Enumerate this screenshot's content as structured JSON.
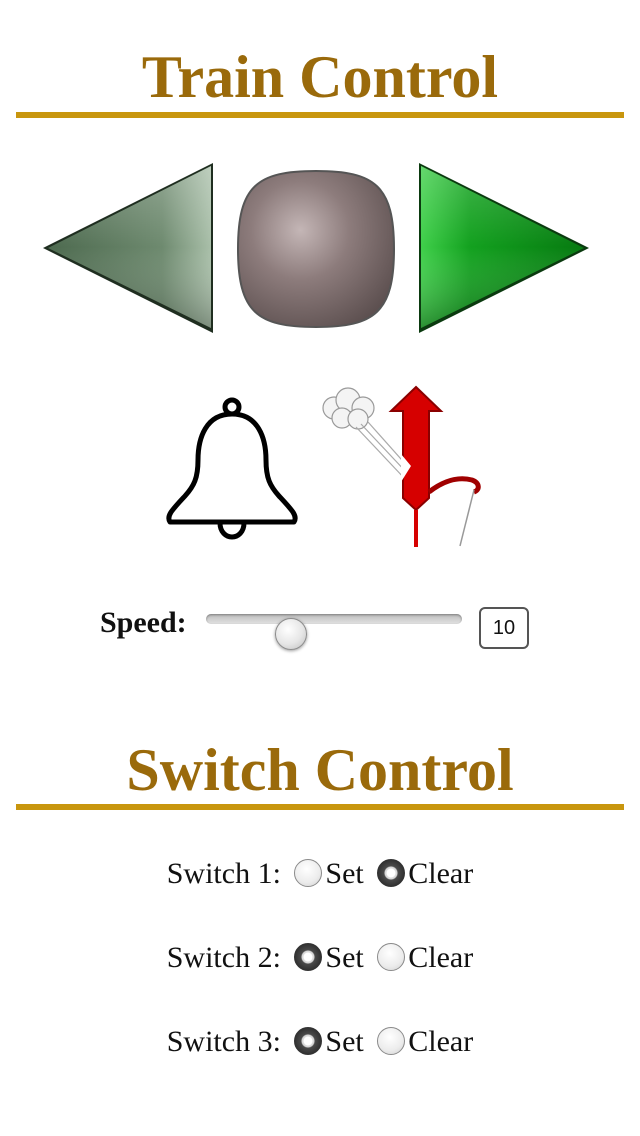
{
  "train_control": {
    "title": "Train Control",
    "buttons": {
      "reverse": "reverse-arrow-icon",
      "stop": "stop-button-icon",
      "forward": "forward-arrow-icon",
      "bell": "bell-icon",
      "whistle": "whistle-icon"
    },
    "speed": {
      "label": "Speed:",
      "value": "10",
      "slider_fraction": 0.33
    }
  },
  "switch_control": {
    "title": "Switch Control",
    "set_label": "Set",
    "clear_label": "Clear",
    "switches": [
      {
        "label": "Switch 1:",
        "selected": "Clear"
      },
      {
        "label": "Switch 2:",
        "selected": "Set"
      },
      {
        "label": "Switch 3:",
        "selected": "Set"
      }
    ]
  },
  "colors": {
    "heading": "#9a6a0b",
    "rule": "#c8960e",
    "forward_green": "#0a9a17",
    "reverse_gray_green": "#6f8a70",
    "stop_brown": "#8a7878",
    "whistle_red": "#d60000"
  }
}
